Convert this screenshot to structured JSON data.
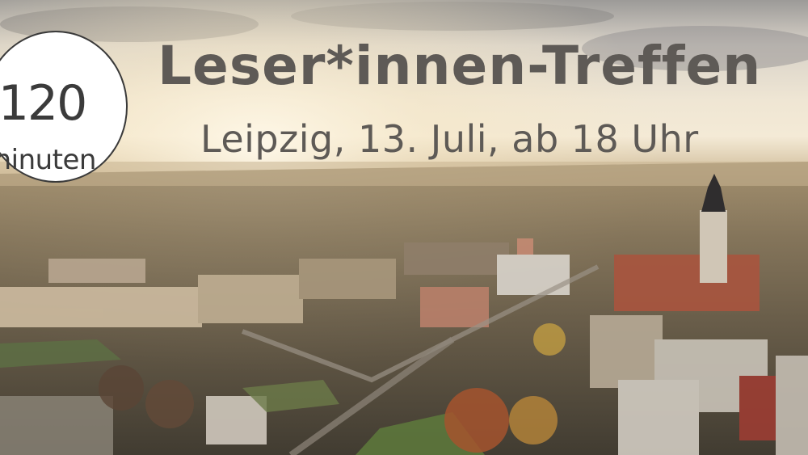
{
  "badge": {
    "number": "120",
    "unit": "minuten"
  },
  "headline": {
    "title": "Leser*innen-Treffen",
    "subtitle": "Leipzig, 13. Juli, ab 18 Uhr"
  },
  "colors": {
    "text": "#5e5a56",
    "badge_bg": "#ffffff",
    "badge_border": "#3a3a3a"
  }
}
